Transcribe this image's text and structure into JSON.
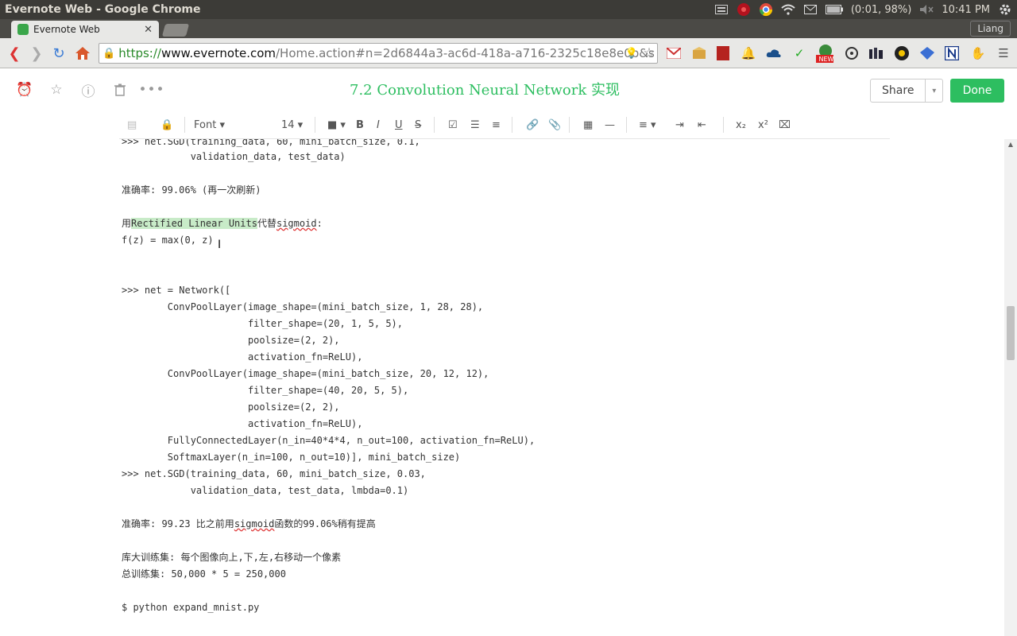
{
  "os": {
    "window_title": "Evernote Web - Google Chrome",
    "battery": "(0:01, 98%)",
    "clock": "10:41 PM"
  },
  "browser": {
    "tab_title": "Evernote Web",
    "profile": "Liang",
    "url_https": "https://",
    "url_host": "www.evernote.com",
    "url_path": "/Home.action#n=2d6844a3-ac6d-418a-a716-2325c18e8e0b&s",
    "ext_badge": "NEW"
  },
  "note": {
    "title": "7.2 Convolution Neural Network 实现",
    "share_label": "Share",
    "done_label": "Done"
  },
  "toolbar": {
    "font": "Font",
    "size": "14"
  },
  "lines": {
    "l0": ">>> net.SGD(training_data, 60, mini_batch_size, 0.1,",
    "l1": "            validation_data, test_data)",
    "l2": "准确率: 99.06% (再一次刷新)",
    "l3_a": "用",
    "l3_b": "Rectified Linear Units",
    "l3_c": "代替",
    "l3_d": "sigmoid",
    "l3_e": ":",
    "l4": "f(z) = max(0, z)",
    "l5": ">>> net = Network([",
    "l6": "        ConvPoolLayer(image_shape=(mini_batch_size, 1, 28, 28),",
    "l7": "                      filter_shape=(20, 1, 5, 5),",
    "l8": "                      poolsize=(2, 2),",
    "l9": "                      activation_fn=ReLU),",
    "l10": "        ConvPoolLayer(image_shape=(mini_batch_size, 20, 12, 12),",
    "l11": "                      filter_shape=(40, 20, 5, 5),",
    "l12": "                      poolsize=(2, 2),",
    "l13": "                      activation_fn=ReLU),",
    "l14": "        FullyConnectedLayer(n_in=40*4*4, n_out=100, activation_fn=ReLU),",
    "l15": "        SoftmaxLayer(n_in=100, n_out=10)], mini_batch_size)",
    "l16": ">>> net.SGD(training_data, 60, mini_batch_size, 0.03,",
    "l17": "            validation_data, test_data, lmbda=0.1)",
    "l18_a": "准确率: 99.23 比之前用",
    "l18_b": "sigmoid",
    "l18_c": "函数的99.06%稍有提高",
    "l19": "库大训练集: 每个图像向上,下,左,右移动一个像素",
    "l20": "总训练集: 50,000 * 5 = 250,000",
    "l21": "$ python expand_mnist.py"
  },
  "colors": {
    "evernote_green": "#2dbe60",
    "highlight": "#c8ebc8"
  }
}
